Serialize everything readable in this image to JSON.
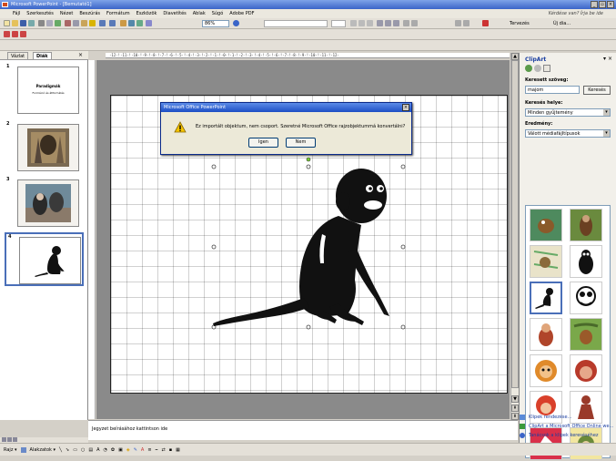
{
  "window": {
    "title": "Microsoft PowerPoint - [Bemutató1]"
  },
  "menu": {
    "items": [
      "Fájl",
      "Szerkesztés",
      "Nézet",
      "Beszúrás",
      "Formátum",
      "Eszközök",
      "Diavetítés",
      "Ablak",
      "Súgó",
      "Adobe PDF"
    ],
    "help_hint": "Kérdése van? Írja be ide"
  },
  "toolbar": {
    "zoom": "86%",
    "design_label": "Tervezés",
    "new_slide_label": "Új dia..."
  },
  "left_pane": {
    "tab_outline": "Vázlat",
    "tab_slides": "Diák",
    "close": "×",
    "slide1_title": "Paradigmák",
    "slide1_subtitle": "Formáció és átformálás"
  },
  "thumbnails": [
    {
      "number": "1"
    },
    {
      "number": "2"
    },
    {
      "number": "3"
    },
    {
      "number": "4"
    }
  ],
  "ruler": {
    "top_text": "·12·!·11·!·10·!·9·!·8·!·7·!·6·!·5·!·4·!·3·!·2·!·1·!·0·!·1·!·2·!·3·!·4·!·5·!·6·!·7·!·8·!·9·!·10·!·11·!·12·"
  },
  "dialog": {
    "title": "Microsoft Office PowerPoint",
    "message": "Ez importált objektum, nem csoport. Szeretné Microsoft Office rajzobjektummá konvertálni?",
    "yes": "Igen",
    "no": "Nem",
    "close": "×"
  },
  "notes": {
    "placeholder": "Jegyzet beírásához kattintson ide"
  },
  "clipart": {
    "title": "ClipArt",
    "search_label": "Keresett szöveg:",
    "search_value": "majom",
    "search_button": "Keresés",
    "location_label": "Keresés helye:",
    "location_value": "Minden gyűjtemény",
    "results_label": "Eredmény:",
    "results_value": "Válott médiafájltípusok",
    "links": [
      "Klipek rendezése...",
      "ClipArt a Microsoft Office Online we...",
      "Tanácsok a klipek kereséséhez"
    ]
  },
  "drawing": {
    "draw_label": "Rajz ▾",
    "autoshapes_label": "Alakzatok ▾"
  },
  "colors": {
    "accent": "#3a64c8",
    "panel": "#f2f0ea"
  }
}
